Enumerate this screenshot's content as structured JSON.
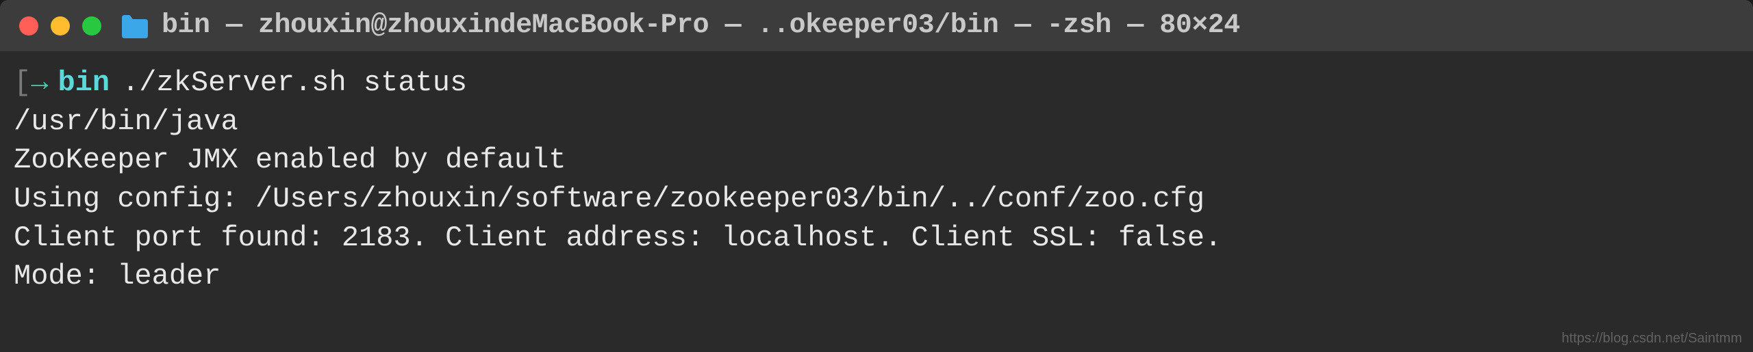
{
  "titlebar": {
    "title": "bin — zhouxin@zhouxindeMacBook-Pro — ..okeeper03/bin — -zsh — 80×24"
  },
  "prompt": {
    "arrow": "→",
    "dir": "bin",
    "command": "./zkServer.sh status"
  },
  "output": {
    "line1": "/usr/bin/java",
    "line2": "ZooKeeper JMX enabled by default",
    "line3": "Using config: /Users/zhouxin/software/zookeeper03/bin/../conf/zoo.cfg",
    "line4": "Client port found: 2183. Client address: localhost. Client SSL: false.",
    "line5": "Mode: leader"
  },
  "watermark": "https://blog.csdn.net/Saintmm"
}
